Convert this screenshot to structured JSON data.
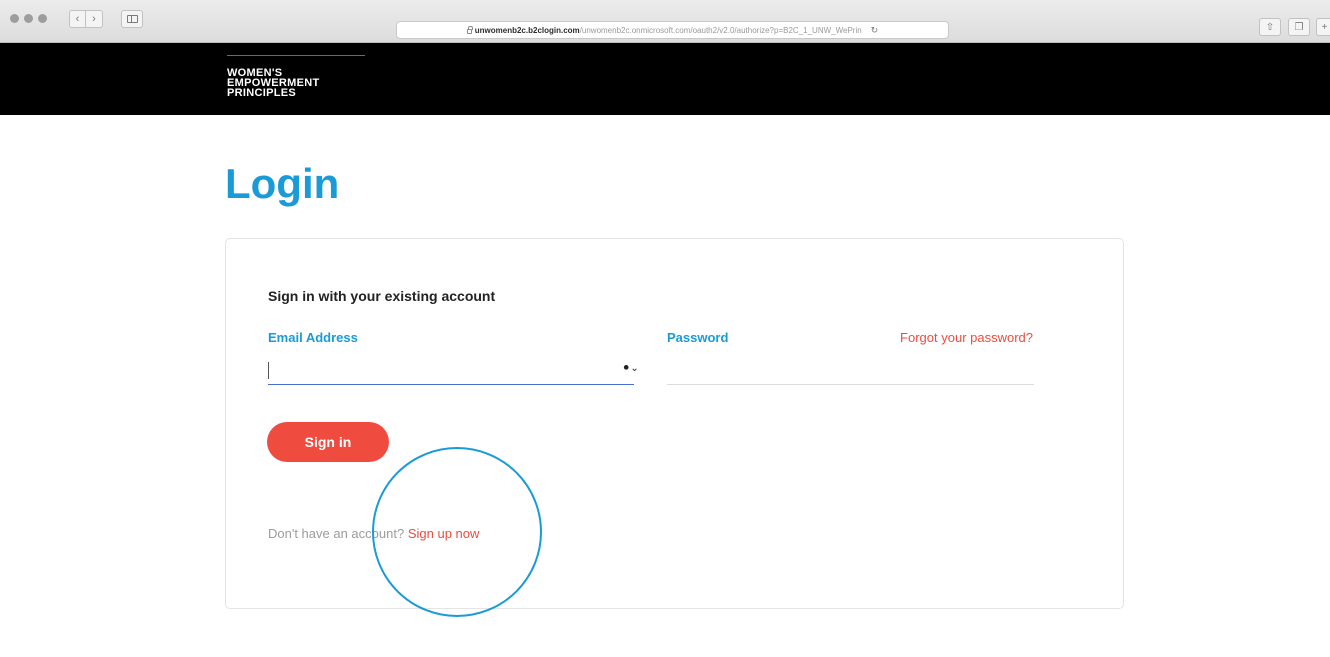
{
  "browser": {
    "url_domain": "unwomenb2c.b2clogin.com",
    "url_path": "/unwomenb2c.onmicrosoft.com/oauth2/v2.0/authorize?p=B2C_1_UNW_WePrin",
    "icons": {
      "back": "chevron-left-icon",
      "forward": "chevron-right-icon",
      "sidebar": "sidebar-icon",
      "lock": "lock-icon",
      "reload": "reload-icon",
      "share": "share-icon",
      "tabs": "tabs-icon",
      "new_tab": "plus-icon"
    }
  },
  "site": {
    "logo_lines": [
      "WOMEN'S",
      "EMPOWERMENT",
      "PRINCIPLES"
    ]
  },
  "page": {
    "title": "Login"
  },
  "form": {
    "heading": "Sign in with your existing account",
    "email_label": "Email Address",
    "email_value": "",
    "password_label": "Password",
    "password_value": "",
    "forgot_link": "Forgot your password?",
    "signin_button": "Sign in",
    "signup_prompt": "Don't have an account?",
    "signup_link": "Sign up now"
  },
  "colors": {
    "accent_blue": "#1a9bd7",
    "accent_red": "#ef4b3e",
    "header_bg": "#000000"
  }
}
